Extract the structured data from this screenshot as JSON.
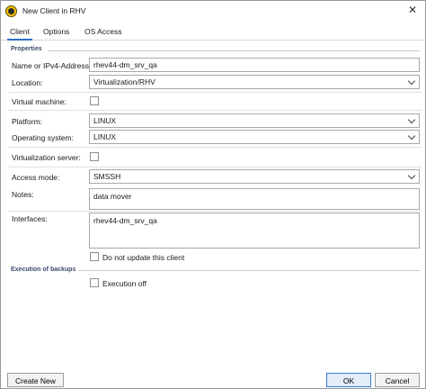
{
  "window": {
    "title": "New Client in RHV",
    "close_glyph": "✕"
  },
  "tabs": [
    {
      "label": "Client",
      "active": true
    },
    {
      "label": "Options",
      "active": false
    },
    {
      "label": "OS Access",
      "active": false
    }
  ],
  "properties": {
    "section_label": "Properties",
    "name": {
      "label": "Name or IPv4-Address:",
      "value": "rhev44-dm_srv_qa"
    },
    "location": {
      "label": "Location:",
      "value": "Virtualization/RHV"
    },
    "virtual_machine": {
      "label": "Virtual machine:",
      "checked": false
    },
    "platform": {
      "label": "Platform:",
      "value": "LINUX"
    },
    "operating_system": {
      "label": "Operating system:",
      "value": "LINUX"
    },
    "virtualization_server": {
      "label": "Virtualization server:",
      "checked": false
    },
    "access_mode": {
      "label": "Access mode:",
      "value": "SMSSH"
    },
    "notes": {
      "label": "Notes:",
      "value": "data mover"
    },
    "interfaces": {
      "label": "Interfaces:",
      "value": "rhev44-dm_srv_qa"
    },
    "do_not_update": {
      "label": "Do not update this client",
      "checked": false
    }
  },
  "execution": {
    "section_label": "Execution of backups",
    "execution_off": {
      "label": "Execution off",
      "checked": false
    }
  },
  "buttons": {
    "create_new": "Create New",
    "ok": "OK",
    "cancel": "Cancel"
  },
  "colors": {
    "accent": "#2d6fcf",
    "app_icon": "#f2c400"
  }
}
